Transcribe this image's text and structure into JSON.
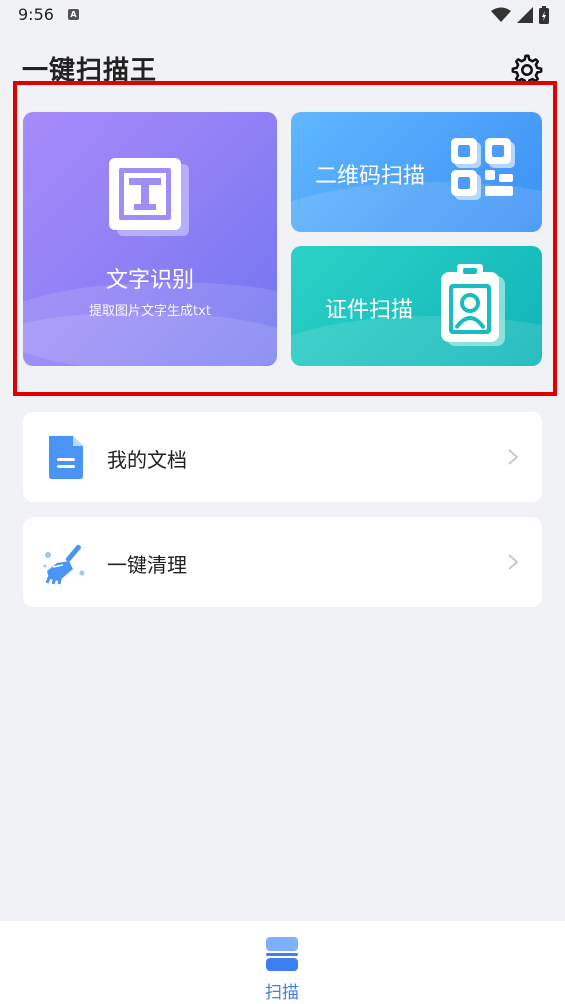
{
  "status": {
    "time": "9:56",
    "notification_letter": "A"
  },
  "header": {
    "title": "一键扫描王"
  },
  "cards": {
    "ocr": {
      "title": "文字识别",
      "subtitle": "提取图片文字生成txt"
    },
    "qr": {
      "label": "二维码扫描"
    },
    "id": {
      "label": "证件扫描"
    }
  },
  "list": [
    {
      "label": "我的文档",
      "icon": "document-icon"
    },
    {
      "label": "一键清理",
      "icon": "broom-icon"
    }
  ],
  "bottom_nav": {
    "scan_label": "扫描"
  },
  "colors": {
    "accent": "#3d7ef2",
    "highlight": "#e00000"
  }
}
